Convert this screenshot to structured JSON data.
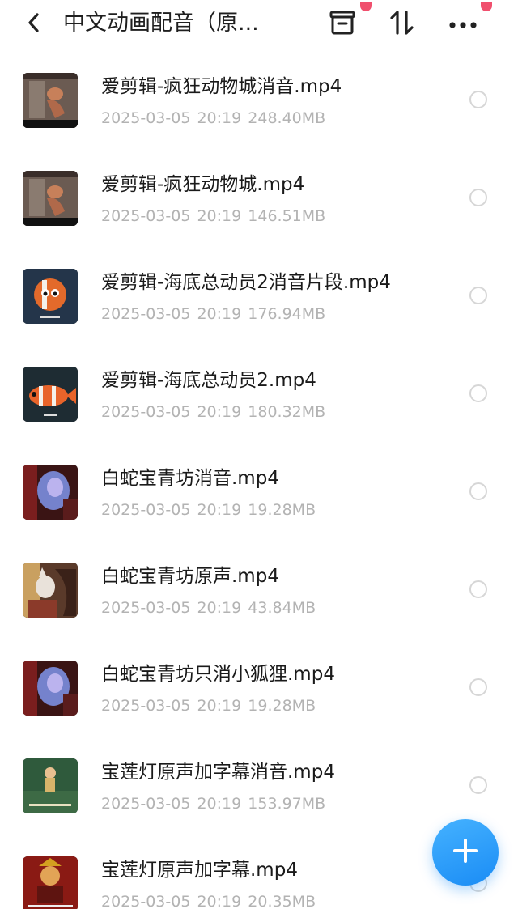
{
  "header": {
    "title": "中文动画配音（原...",
    "back_icon": "chevron-left-icon",
    "archive_icon": "archive-box-icon",
    "sort_icon": "sort-arrows-icon",
    "more_icon": "more-horizontal-icon",
    "badge_color": "#f0506e"
  },
  "files": [
    {
      "name": "爱剪辑-疯狂动物城消音.mp4",
      "date": "2025-03-05",
      "time": "20:19",
      "size": "248.40MB",
      "thumb": "zootopia"
    },
    {
      "name": "爱剪辑-疯狂动物城.mp4",
      "date": "2025-03-05",
      "time": "20:19",
      "size": "146.51MB",
      "thumb": "zootopia"
    },
    {
      "name": "爱剪辑-海底总动员2消音片段.mp4",
      "date": "2025-03-05",
      "time": "20:19",
      "size": "176.94MB",
      "thumb": "nemo-face"
    },
    {
      "name": "爱剪辑-海底总动员2.mp4",
      "date": "2025-03-05",
      "time": "20:19",
      "size": "180.32MB",
      "thumb": "nemo-side"
    },
    {
      "name": "白蛇宝青坊消音.mp4",
      "date": "2025-03-05",
      "time": "20:19",
      "size": "19.28MB",
      "thumb": "whitesnake-blur"
    },
    {
      "name": "白蛇宝青坊原声.mp4",
      "date": "2025-03-05",
      "time": "20:19",
      "size": "43.84MB",
      "thumb": "whitesnake-fox"
    },
    {
      "name": "白蛇宝青坊只消小狐狸.mp4",
      "date": "2025-03-05",
      "time": "20:19",
      "size": "19.28MB",
      "thumb": "whitesnake-blur"
    },
    {
      "name": "宝莲灯原声加字幕消音.mp4",
      "date": "2025-03-05",
      "time": "20:19",
      "size": "153.97MB",
      "thumb": "lotus-green"
    },
    {
      "name": "宝莲灯原声加字幕.mp4",
      "date": "2025-03-05",
      "time": "20:19",
      "size": "20.35MB",
      "thumb": "lotus-red"
    }
  ],
  "fab": {
    "icon": "plus-icon",
    "color": "#1a8cf5"
  }
}
